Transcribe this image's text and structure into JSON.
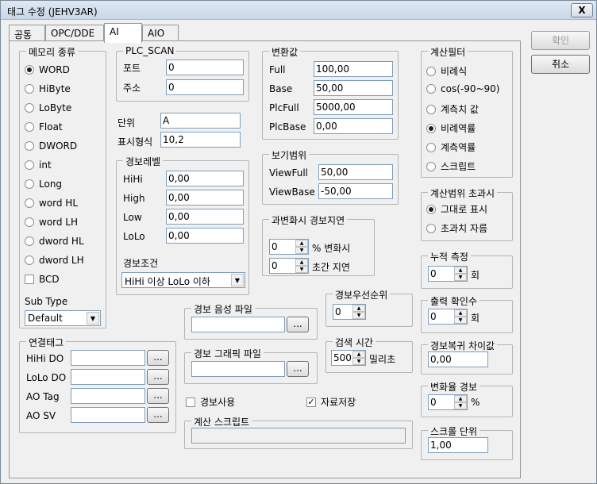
{
  "window": {
    "title": "태그 수정 (JEHV3AR)",
    "close_label": "X"
  },
  "tabs": [
    "공통",
    "OPC/DDE",
    "AI",
    "AIO"
  ],
  "buttons": {
    "ok": "확인",
    "cancel": "취소"
  },
  "memory": {
    "title": "메모리 종류",
    "options": [
      "WORD",
      "HiByte",
      "LoByte",
      "Float",
      "DWORD",
      "int",
      "Long",
      "word HL",
      "word LH",
      "dword HL",
      "dword LH"
    ],
    "selected": "WORD",
    "bcd_label": "BCD",
    "subtype_label": "Sub Type",
    "subtype_value": "Default"
  },
  "plc_scan": {
    "title": "PLC_SCAN",
    "port_label": "포트",
    "port_value": "0",
    "addr_label": "주소",
    "addr_value": "0"
  },
  "unit": {
    "label": "단위",
    "value": "A"
  },
  "display_format": {
    "label": "표시형식",
    "value": "10,2"
  },
  "alarm_level": {
    "title": "경보레벨",
    "hihi_label": "HiHi",
    "hihi_value": "0,00",
    "high_label": "High",
    "high_value": "0,00",
    "low_label": "Low",
    "low_value": "0,00",
    "lolo_label": "LoLo",
    "lolo_value": "0,00",
    "cond_label": "경보조건",
    "cond_value": "HiHi 이상 LoLo 이하"
  },
  "conversion": {
    "title": "변환값",
    "full_label": "Full",
    "full_value": "100,00",
    "base_label": "Base",
    "base_value": "50,00",
    "plcfull_label": "PlcFull",
    "plcfull_value": "5000,00",
    "plcbase_label": "PlcBase",
    "plcbase_value": "0,00"
  },
  "view_range": {
    "title": "보기범위",
    "viewfull_label": "ViewFull",
    "viewfull_value": "50,00",
    "viewbase_label": "ViewBase",
    "viewbase_value": "-50,00"
  },
  "change_alarm_delay": {
    "title": "과변화시 경보지연",
    "pct_value": "0",
    "pct_label": "% 변화시",
    "sec_value": "0",
    "sec_label": "초간 지연"
  },
  "calc_filter": {
    "title": "계산필터",
    "options": [
      "비례식",
      "cos(-90~90)",
      "계측치 값",
      "비례역률",
      "계측역률",
      "스크립트"
    ],
    "selected": "비례역률"
  },
  "calc_range_exceed": {
    "title": "계산범위 초과시",
    "options": [
      "그대로 표시",
      "초과치 자름"
    ],
    "selected": "그대로 표시"
  },
  "accumulate": {
    "title": "누적 측정",
    "value": "0",
    "unit": "회"
  },
  "output_confirm": {
    "title": "출력 확인수",
    "value": "0",
    "unit": "회"
  },
  "alarm_recover_diff": {
    "title": "경보복귀 차이값",
    "value": "0,00"
  },
  "change_rate_alarm": {
    "title": "변화율 경보",
    "value": "0",
    "unit": "%"
  },
  "scroll_unit": {
    "title": "스크롤 단위",
    "value": "1,00"
  },
  "alarm_priority": {
    "title": "경보우선순위",
    "value": "0"
  },
  "search_time": {
    "title": "검색 시간",
    "value": "500",
    "unit": "밀리초"
  },
  "alarm_sound_file": {
    "title": "경보 음성 파일",
    "value": "",
    "browse": "..."
  },
  "alarm_graphic_file": {
    "title": "경보 그래픽 파일",
    "value": "",
    "browse": "..."
  },
  "alarm_use": {
    "label": "경보사용",
    "checked": false
  },
  "data_save": {
    "label": "자료저장",
    "checked": true
  },
  "calc_script": {
    "title": "계산 스크립트",
    "value": ""
  },
  "linked_tags": {
    "title": "연결태그",
    "rows": [
      {
        "label": "HiHi DO",
        "value": "",
        "browse": "..."
      },
      {
        "label": "LoLo DO",
        "value": "",
        "browse": "..."
      },
      {
        "label": "AO Tag",
        "value": "",
        "browse": "..."
      },
      {
        "label": "AO SV",
        "value": "",
        "browse": "..."
      }
    ]
  }
}
